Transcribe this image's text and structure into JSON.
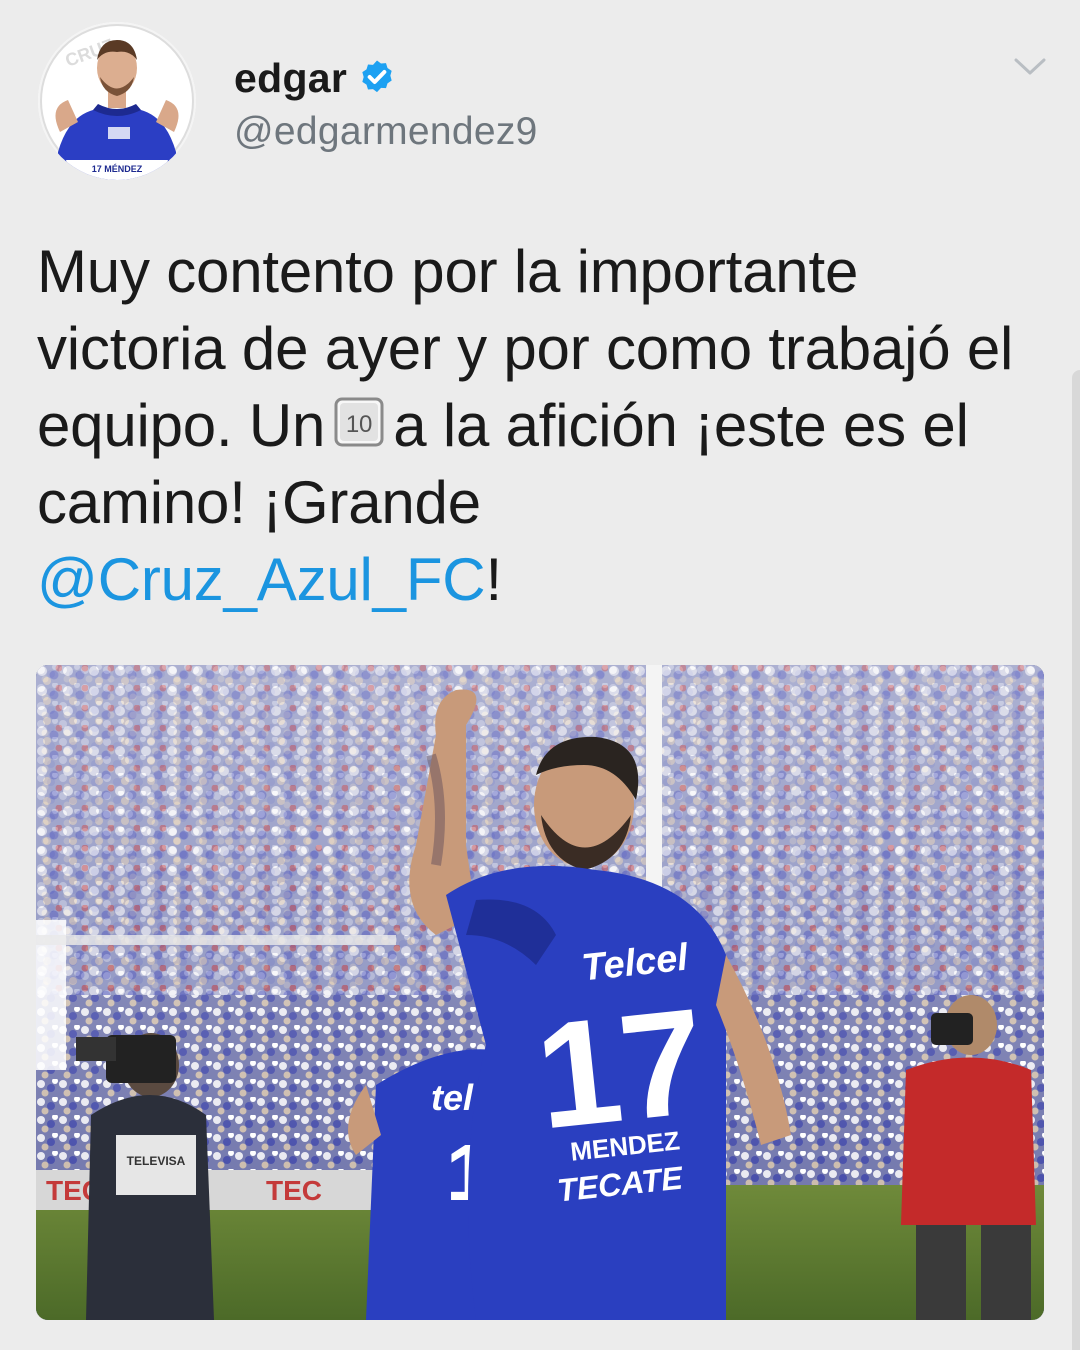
{
  "tweet": {
    "display_name": "edgar",
    "verified": true,
    "handle": "@edgarmendez9",
    "text_part1": "Muy contento por la importante victoria de ayer y por como trabajó el equipo. Un",
    "keycap_emoji": "🔟",
    "text_part2": "a la afición ¡este es el camino! ¡Grande",
    "mention": "@Cruz_Azul_FC",
    "text_end": "!"
  },
  "avatar": {
    "jersey_text": "CRUZ AZUL",
    "nameplate": "17 MÉNDEZ"
  },
  "photo": {
    "jersey_sponsor": "Telcel",
    "jersey_number": "17",
    "jersey_name": "MENDEZ",
    "jersey_sponsor_2": "TECATE",
    "teammate_sponsor": "tel",
    "teammate_number": "1",
    "camera_vest_text": "TELEVISA"
  },
  "colors": {
    "background": "#ececec",
    "mention": "#1b95e0",
    "verified": "#1da1f2",
    "handle": "#6e767d",
    "jersey_blue": "#2a3fc0"
  },
  "icons": {
    "verified": "verified-badge-icon",
    "caret": "chevron-down-icon",
    "keycap": "keycap-ten-icon"
  }
}
